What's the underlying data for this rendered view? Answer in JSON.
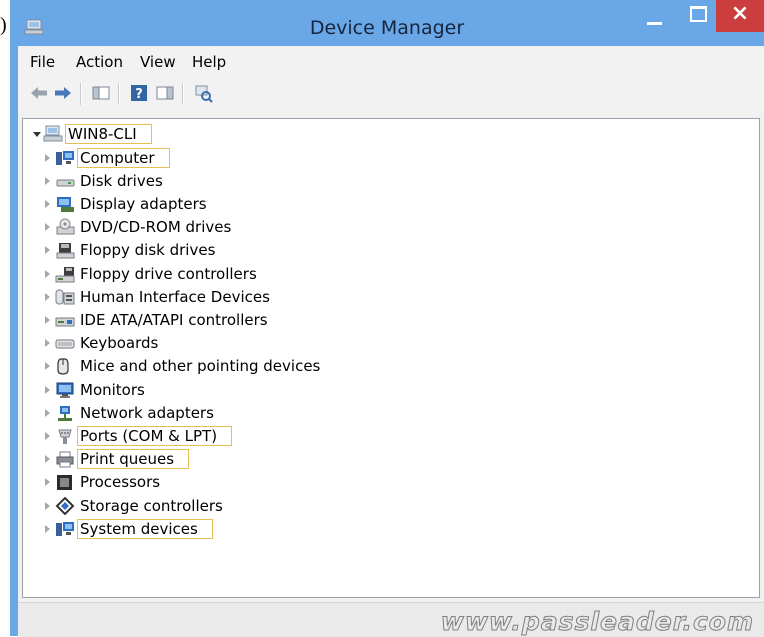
{
  "edge_char": ")",
  "window": {
    "title": "Device Manager",
    "icon": "device-manager-icon",
    "controls": {
      "minimize": "minimize-icon",
      "maximize": "maximize-icon",
      "close": "×"
    }
  },
  "menu": [
    "File",
    "Action",
    "View",
    "Help"
  ],
  "toolbar": [
    "back-arrow-icon",
    "forward-arrow-icon",
    "show-hide-console-tree-icon",
    "help-icon",
    "show-hide-action-pane-icon",
    "scan-hardware-changes-icon"
  ],
  "tree": {
    "root": {
      "label": "WIN8-CLI",
      "icon": "computer-root-icon",
      "highlighted": true,
      "expanded": true
    },
    "children": [
      {
        "label": "Computer",
        "icon": "computer-icon",
        "highlighted": true
      },
      {
        "label": "Disk drives",
        "icon": "disk-drive-icon",
        "highlighted": false
      },
      {
        "label": "Display adapters",
        "icon": "display-adapter-icon",
        "highlighted": false
      },
      {
        "label": "DVD/CD-ROM drives",
        "icon": "dvd-drive-icon",
        "highlighted": false
      },
      {
        "label": "Floppy disk drives",
        "icon": "floppy-disk-icon",
        "highlighted": false
      },
      {
        "label": "Floppy drive controllers",
        "icon": "floppy-controller-icon",
        "highlighted": false
      },
      {
        "label": "Human Interface Devices",
        "icon": "hid-icon",
        "highlighted": false
      },
      {
        "label": "IDE ATA/ATAPI controllers",
        "icon": "ide-controller-icon",
        "highlighted": false
      },
      {
        "label": "Keyboards",
        "icon": "keyboard-icon",
        "highlighted": false
      },
      {
        "label": "Mice and other pointing devices",
        "icon": "mouse-icon",
        "highlighted": false
      },
      {
        "label": "Monitors",
        "icon": "monitor-icon",
        "highlighted": false
      },
      {
        "label": "Network adapters",
        "icon": "network-adapter-icon",
        "highlighted": false
      },
      {
        "label": "Ports (COM & LPT)",
        "icon": "port-icon",
        "highlighted": true
      },
      {
        "label": "Print queues",
        "icon": "printer-icon",
        "highlighted": true
      },
      {
        "label": "Processors",
        "icon": "processor-icon",
        "highlighted": false
      },
      {
        "label": "Storage controllers",
        "icon": "storage-controller-icon",
        "highlighted": false
      },
      {
        "label": "System devices",
        "icon": "system-devices-icon",
        "highlighted": true
      }
    ]
  },
  "watermark": "www.passleader.com"
}
